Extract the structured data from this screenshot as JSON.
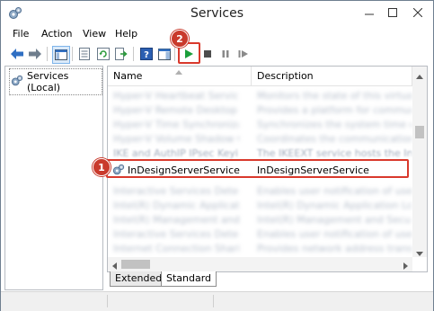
{
  "window": {
    "title": "Services"
  },
  "menu": [
    "File",
    "Action",
    "View",
    "Help"
  ],
  "tree": {
    "root_label": "Services (Local)"
  },
  "columns": {
    "name": "Name",
    "description": "Description"
  },
  "services": [
    {
      "name": "Hyper-V Heartbeat Service",
      "description": "Monitors the state of this virtual machine"
    },
    {
      "name": "Hyper-V Remote Desktop Virtualization",
      "description": "Provides a platform for communication"
    },
    {
      "name": "Hyper-V Time Synchronization",
      "description": "Synchronizes the system time of this"
    },
    {
      "name": "Hyper-V Volume Shadow Copy",
      "description": "Coordinates the communications that"
    },
    {
      "name": "IKE and AuthIP IPsec Keying",
      "description": "The IKEEXT service hosts the Internet"
    }
  ],
  "selected_service": {
    "name": "InDesignServerService",
    "description": "InDesignServerService"
  },
  "services_after": [
    {
      "name": "Interactive Services Detection",
      "description": "Enables user notification of user input"
    },
    {
      "name": "Intel(R) Dynamic Application Loader",
      "description": "Intel(R) Dynamic Application Loader Host"
    },
    {
      "name": "Intel(R) Management and Security",
      "description": "Intel(R) Management and Security Applic"
    },
    {
      "name": "Interactive Services Detection",
      "description": "Enables user notification of user input"
    },
    {
      "name": "Internet Connection Sharing (ICS)",
      "description": "Provides network address translation"
    }
  ],
  "tabs": [
    "Extended",
    "Standard"
  ],
  "callouts": {
    "selected_row": "1",
    "start_button": "2"
  },
  "colors": {
    "callout": "#d9392c",
    "start_green": "#1a9e3a",
    "toolbar_blue": "#2f6fc3"
  }
}
